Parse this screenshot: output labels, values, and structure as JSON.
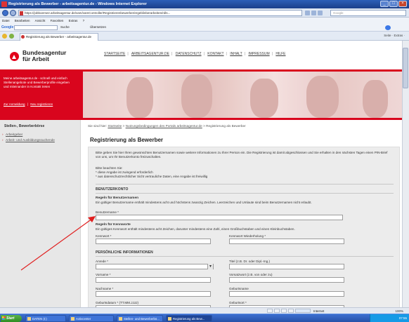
{
  "browser": {
    "window_title": "Registrierung als Bewerber - arbeitsagentur.de - Windows Internet Explorer",
    "url": "https://jobboerse2.arbeitsagentur.de/vam/vamController/Registrierenbewerber/ergeblinberarbeiten/rdls...",
    "search_placeholder": "Google",
    "menu": [
      "Datei",
      "Bearbeiten",
      "Ansicht",
      "Favoriten",
      "Extras",
      "?"
    ],
    "google_label": "Google",
    "google_search_label": "Suche",
    "google_translate_label": "Übersetzen",
    "tab_title": "Registrierung als Bewerber - arbeitsagentur.de",
    "tab_tools": "Seite · Extras ·"
  },
  "page": {
    "brand_line1": "Bundesagentur",
    "brand_line2": "für Arbeit",
    "topnav": [
      "STARTSEITE",
      "ARBEITSAGENTUR.DE",
      "DATENSCHUTZ",
      "KONTAKT",
      "INHALT",
      "IMPRESSUM",
      "HILFE"
    ],
    "red_text": "Meine arbeitsagentur.de - schnell und einfach Stellenangebote und Bewerberprofile eingeben und miteinander in Kontakt treten",
    "red_login": "Zur Anmeldung",
    "red_register": "Neu registrieren"
  },
  "sidebar": {
    "title": "Stellen-, Bewerberbörse",
    "items": [
      {
        "label": "Arbeitgeber"
      },
      {
        "label": "Arbeit- und Ausbildungssuchende"
      }
    ]
  },
  "content": {
    "breadcrumb_prefix": "Sie sind hier:",
    "breadcrumb": [
      "Startseite",
      "Nutzungsbedingungen des Portals arbeitsagentur.de",
      "Registrierung als Bewerber"
    ],
    "title": "Registrierung als Bewerber",
    "intro": "Bitte geben Sie hier Ihren gewünschten Benutzernamen sowie weitere Informationen zu Ihrer Person ein. Die Registrierung ist damit abgeschlossen und Sie erhalten in den nächsten Tagen einen PIN-Brief von uns, um Ihr Benutzerkonto freizuschalten.",
    "note_title": "Bitte beachten Sie:",
    "note_required": "* diese Angabe ist zwingend erforderlich",
    "note_optional": "* aus datenschutzrechtlicher Sicht vertrauliche Daten, eine Angabe ist freiwillig",
    "section_account": "BENUTZERKONTO",
    "rule_username_title": "Regeln für Benutzernamen",
    "rule_username_text": "Ein gültiger Benutzername enthält mindestens acht und höchstens zwanzig Zeichen. Leerzeichen und Umlaute sind beim Benutzernamen nicht erlaubt.",
    "label_username": "Benutzername *",
    "rule_password_title": "Regeln für Kennworte",
    "rule_password_text": "Ein gültiges Kennwort enthält mindestens acht Zeichen, darunter mindestens eine Zahl, einen Großbuchstaben und einen Kleinbuchstaben.",
    "label_password": "Kennwort *",
    "label_password_repeat": "Kennwort Wiederholung *",
    "section_personal": "PERSÖNLICHE INFORMATIONEN",
    "label_salutation": "Anrede *",
    "label_title": "Titel (z.B. Dr. oder Dipl.-Ing.)",
    "label_firstname": "Vorname *",
    "label_prefix": "Vorsatzwort (z.B. von oder zu)",
    "label_lastname": "Nachname *",
    "label_birthname": "Geburtsname",
    "label_birthdate": "Geburtsdatum * (TT.MM.JJJJ)",
    "label_birthplace": "Geburtsort *"
  },
  "statusbar": {
    "zone": "Internet",
    "zoom": "100%"
  },
  "taskbar": {
    "start": "Start",
    "tasks": [
      "DATEN (I:)",
      "Activcenter",
      "Stellen- und Bewerberbö...",
      "Registrierung als Bew..."
    ],
    "clock": "07:55"
  },
  "colors": {
    "brand_red": "#d9051d",
    "annotation_arrow": "#e02020"
  }
}
